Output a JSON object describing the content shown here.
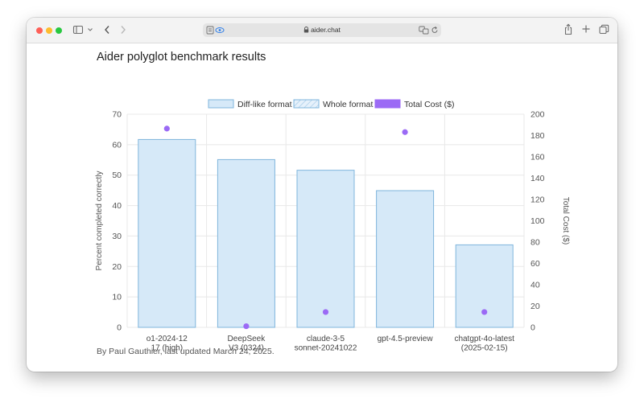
{
  "browser": {
    "url": "aider.chat"
  },
  "page": {
    "title": "Aider polyglot benchmark results",
    "footer": "By Paul Gauthier, last updated March 24, 2025."
  },
  "legend": {
    "items": [
      {
        "label": "Diff-like format",
        "icon": "solid-box"
      },
      {
        "label": "Whole format",
        "icon": "hatched-box"
      },
      {
        "label": "Total Cost ($)",
        "icon": "purple-box"
      }
    ]
  },
  "colors": {
    "bar_fill": "#d6e9f8",
    "bar_stroke": "#7fb5dc",
    "cost_point": "#9b6af5",
    "grid": "#e8e8e8"
  },
  "chart_data": {
    "type": "bar",
    "categories": [
      [
        "o1-2024-12",
        "17 (high)"
      ],
      [
        "DeepSeek",
        "V3 (0324)"
      ],
      [
        "claude-3-5",
        "sonnet-20241022"
      ],
      [
        "gpt-4.5-preview"
      ],
      [
        "chatgpt-4o-latest",
        "(2025-02-15)"
      ]
    ],
    "series": [
      {
        "name": "Diff-like format",
        "axis": "left",
        "values": [
          61.7,
          55.1,
          51.6,
          44.9,
          27.1
        ]
      },
      {
        "name": "Total Cost ($)",
        "axis": "right",
        "values": [
          186.5,
          1.1,
          14.4,
          183.2,
          14.4
        ]
      }
    ],
    "ylabel": "Percent completed correctly",
    "y2label": "Total Cost ($)",
    "ylim": [
      0,
      70
    ],
    "y2lim": [
      0,
      200
    ],
    "yticks": [
      0,
      10,
      20,
      30,
      40,
      50,
      60,
      70
    ],
    "y2ticks": [
      0,
      20,
      40,
      60,
      80,
      100,
      120,
      140,
      160,
      180,
      200
    ],
    "grid": true,
    "legend_position": "top"
  }
}
